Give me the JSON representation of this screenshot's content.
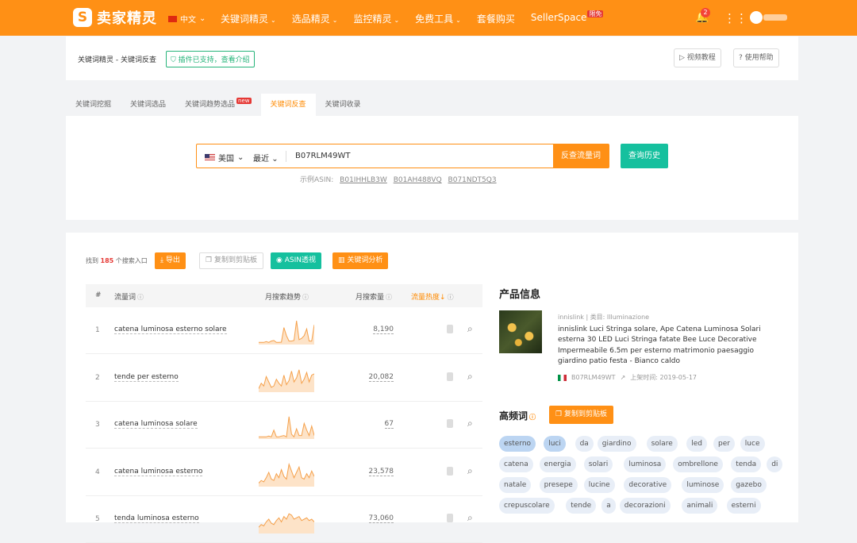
{
  "topbar": {
    "logo_mark": "S",
    "logo_text": "卖家精灵",
    "lang": "中文",
    "nav": [
      "关键词精灵",
      "选品精灵",
      "监控精灵",
      "免费工具",
      "套餐购买",
      "SellerSpace"
    ],
    "nav_has_dropdown": [
      true,
      true,
      true,
      true,
      false,
      false
    ],
    "sellerspace_badge": "限免",
    "notif_count": "2",
    "chev": "⌄",
    "bell_glyph": "🔔",
    "grid_glyph": "⋮⋮"
  },
  "header": {
    "breadcrumb": "关键词精灵 - 关键词反查",
    "plugin_notice": "插件已支持，查看介绍",
    "video_btn": "视频教程",
    "help_btn": "使用帮助"
  },
  "tabs": [
    {
      "label": "关键词挖掘"
    },
    {
      "label": "关键词选品"
    },
    {
      "label": "关键词趋势选品",
      "badge": "new"
    },
    {
      "label": "关键词反查",
      "active": true
    },
    {
      "label": "关键词收录"
    }
  ],
  "search": {
    "country": "美国",
    "period": "最近",
    "value": "B07RLM49WT",
    "submit": "反查流量词",
    "history": "查询历史",
    "examples_label": "示例ASIN:",
    "examples": [
      "B01IHHLB3W",
      "B01AH488VQ",
      "B071NDT5Q3"
    ]
  },
  "results": {
    "found_prefix": "找到",
    "found_count": "185",
    "found_suffix": "个搜索入口",
    "export": "导出",
    "copy": "复制到剪贴板",
    "asin_view": "ASIN透视",
    "kw_analysis": "关键词分析",
    "columns": {
      "idx": "#",
      "kw": "流量词",
      "trend": "月搜索趋势",
      "vol": "月搜索量",
      "heat": "流量热度"
    },
    "rows": [
      {
        "idx": "1",
        "kw": "catena luminosa esterno solare",
        "vol": "8,190",
        "trend": [
          0.05,
          0.05,
          0.05,
          0.08,
          0.05,
          0.1,
          0.12,
          0.05,
          0.05,
          0.06,
          0.6,
          0.3,
          0.1,
          0.1,
          0.12,
          0.85,
          0.15,
          0.2,
          0.3,
          0.55,
          0.1,
          0.1,
          0.7
        ]
      },
      {
        "idx": "2",
        "kw": "tende per esterno",
        "vol": "20,082",
        "trend": [
          0.1,
          0.3,
          0.2,
          0.55,
          0.35,
          0.15,
          0.2,
          0.45,
          0.3,
          0.2,
          0.6,
          0.25,
          0.4,
          0.75,
          0.35,
          0.5,
          0.8,
          0.3,
          0.45,
          0.7,
          0.35,
          0.6,
          0.65
        ]
      },
      {
        "idx": "3",
        "kw": "catena luminosa solare",
        "vol": "67",
        "trend": [
          0.05,
          0.05,
          0.05,
          0.05,
          0.08,
          0.05,
          0.3,
          0.05,
          0.05,
          0.08,
          0.1,
          0.05,
          0.8,
          0.15,
          0.05,
          0.35,
          0.1,
          0.1,
          0.55,
          0.3,
          0.1,
          0.45,
          0.1
        ]
      },
      {
        "idx": "4",
        "kw": "catena luminosa esterno",
        "vol": "23,578",
        "trend": [
          0.1,
          0.2,
          0.15,
          0.3,
          0.5,
          0.25,
          0.2,
          0.45,
          0.3,
          0.6,
          0.35,
          0.25,
          0.8,
          0.55,
          0.3,
          0.5,
          0.7,
          0.3,
          0.25,
          0.45,
          0.3,
          0.55,
          0.35
        ]
      },
      {
        "idx": "5",
        "kw": "tenda luminosa esterno",
        "vol": "73,060",
        "trend": [
          0.2,
          0.3,
          0.25,
          0.4,
          0.5,
          0.35,
          0.3,
          0.45,
          0.55,
          0.4,
          0.6,
          0.5,
          0.7,
          0.65,
          0.5,
          0.55,
          0.6,
          0.45,
          0.5,
          0.55,
          0.45,
          0.5,
          0.4
        ]
      }
    ]
  },
  "product": {
    "title": "产品信息",
    "brand": "innislink",
    "category": "类目: Illuminazione",
    "name": "innislink Luci Stringa solare, Ape Catena Luminosa Solari esterna 30 LED Luci Stringa fatate Bee Luce Decorative Impermeabile 6.5m per esterno matrimonio paesaggio giardino patio festa - Bianco caldo",
    "asin": "B07RLM49WT",
    "listed": "上架时间: 2019-05-17"
  },
  "highfreq": {
    "title": "高频词",
    "copy": "复制到剪贴板",
    "tags": [
      [
        "esterno",
        "luci",
        "da",
        "giardino",
        "solare",
        "led",
        "per",
        "luce"
      ],
      [
        "catena",
        "energia",
        "solari",
        "luminosa",
        "ombrellone",
        "tenda",
        "di"
      ],
      [
        "natale",
        "presepe",
        "lucine",
        "decorative",
        "luminose",
        "gazebo"
      ],
      [
        "crepuscolare",
        "tende",
        "a",
        "decorazioni",
        "animali",
        "esterni"
      ]
    ],
    "highlighted": [
      "esterno",
      "luci"
    ]
  },
  "colors": {
    "brand": "#ff9015",
    "teal": "#15c09e",
    "tag": "#e8eef7",
    "tag_hl": "#bcd5f2"
  }
}
